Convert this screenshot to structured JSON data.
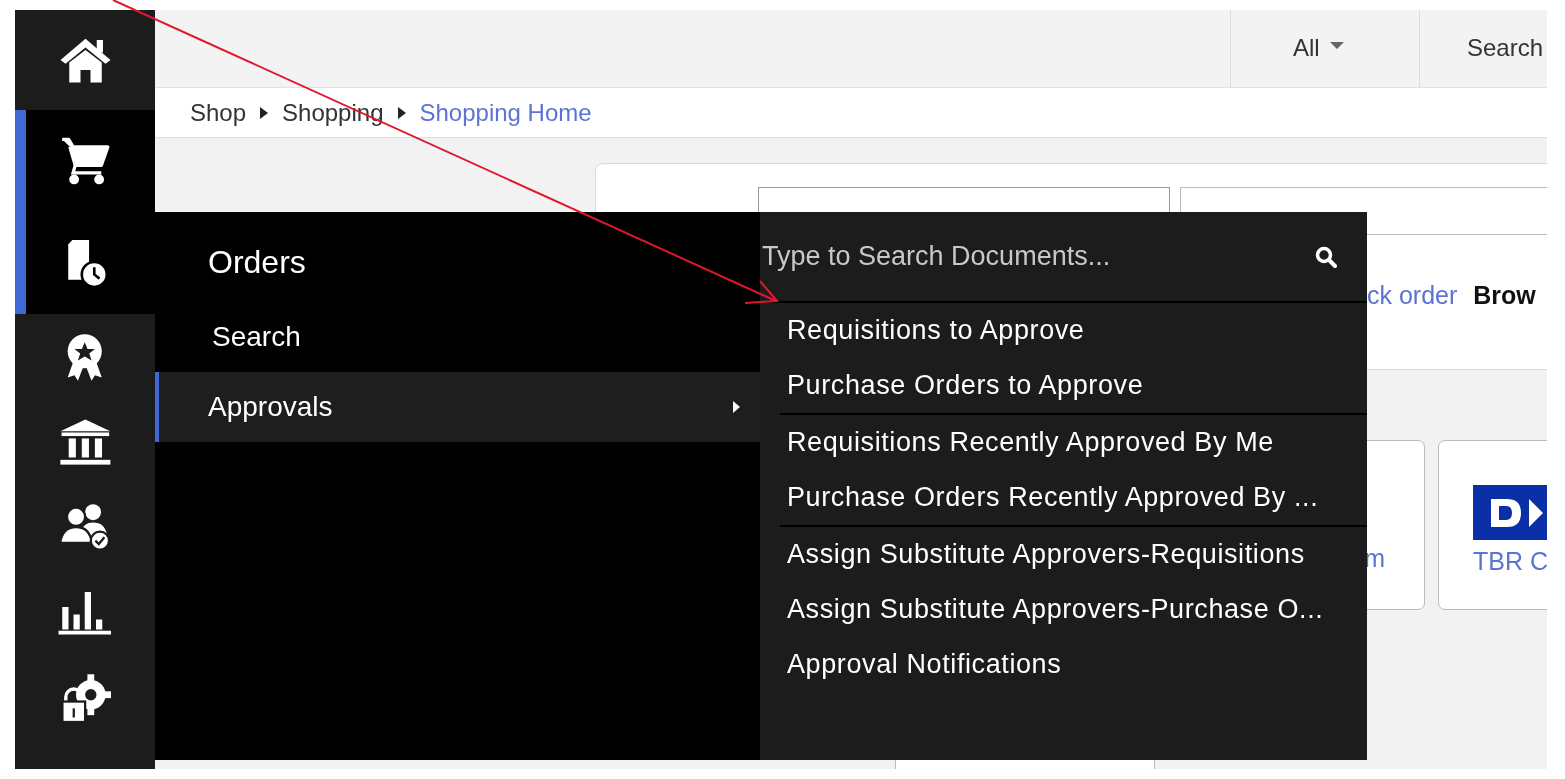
{
  "rail": {
    "items": [
      {
        "kind": "home",
        "selected": false
      },
      {
        "kind": "cart",
        "selected": true
      },
      {
        "kind": "document-clock",
        "selected": true
      },
      {
        "kind": "award",
        "selected": false
      },
      {
        "kind": "bank",
        "selected": false
      },
      {
        "kind": "people-check",
        "selected": false
      },
      {
        "kind": "bar-chart",
        "selected": false
      },
      {
        "kind": "lock-gear",
        "selected": false
      }
    ]
  },
  "header": {
    "scope_dropdown": "All",
    "search_label": "Search"
  },
  "breadcrumb": [
    {
      "label": "Shop",
      "current": false
    },
    {
      "label": "Shopping",
      "current": false
    },
    {
      "label": "Shopping Home",
      "current": true
    }
  ],
  "shop_panel": {
    "links": [
      {
        "label": "ck order",
        "kind": "link"
      },
      {
        "label": "Brow",
        "kind": "bold"
      }
    ],
    "tiles": [
      {
        "label": "m",
        "kind": "text"
      },
      {
        "label": "TBR C",
        "kind": "logo"
      }
    ]
  },
  "menu": {
    "title": "Orders",
    "items": [
      {
        "label": "Search",
        "selected": false,
        "submenu": false
      },
      {
        "label": "Approvals",
        "selected": true,
        "submenu": true
      }
    ],
    "search": {
      "placeholder": "Type to Search Documents..."
    },
    "groups": [
      {
        "items": [
          "Requisitions to Approve",
          "Purchase Orders to Approve"
        ]
      },
      {
        "items": [
          "Requisitions Recently Approved By Me",
          "Purchase Orders Recently Approved By ..."
        ]
      },
      {
        "items": [
          "Assign Substitute Approvers-Requisitions",
          "Assign Substitute Approvers-Purchase O...",
          "Approval Notifications"
        ]
      }
    ]
  }
}
